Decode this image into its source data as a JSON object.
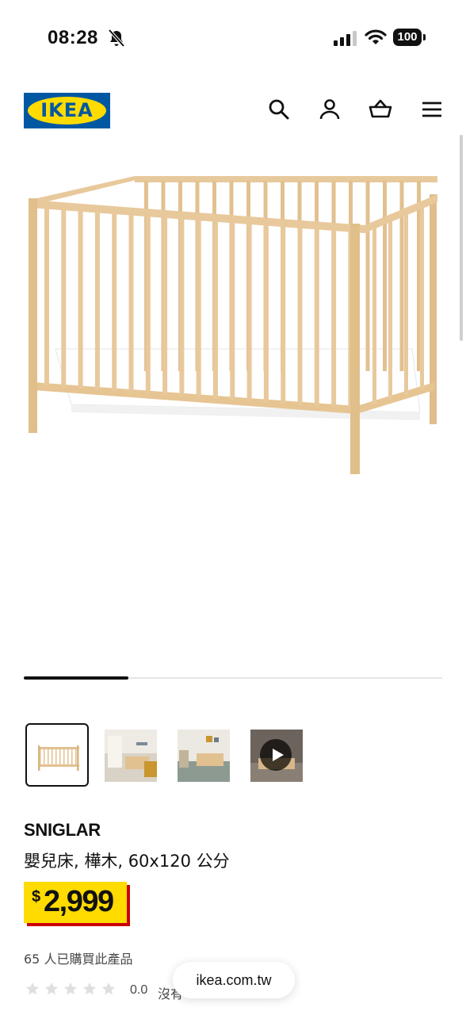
{
  "status_bar": {
    "time": "08:28",
    "battery": "100",
    "icons": [
      "bell-muted-icon",
      "cellular-signal-icon",
      "wifi-icon",
      "battery-icon"
    ]
  },
  "header": {
    "logo_text": "IKEA",
    "icons": [
      "search-icon",
      "account-icon",
      "shopping-basket-icon",
      "menu-icon"
    ]
  },
  "gallery": {
    "progress": 0.25,
    "thumbnails": [
      {
        "label": "product-image",
        "selected": true
      },
      {
        "label": "room-image-1",
        "selected": false
      },
      {
        "label": "room-image-2",
        "selected": false
      },
      {
        "label": "video",
        "selected": false
      }
    ]
  },
  "product": {
    "name": "SNIGLAR",
    "description": "嬰兒床, 樺木, 60x120 公分",
    "currency": "$",
    "price": "2,999",
    "purchased": "65 人已購買此產品",
    "rating_value": "0.0",
    "rating_stars": 0,
    "review_text": "沒有"
  },
  "browser": {
    "url": "ikea.com.tw"
  },
  "colors": {
    "ikea_blue": "#0058a3",
    "ikea_yellow": "#ffdb00",
    "price_red": "#cc0008",
    "wood": "#e8c99c"
  }
}
